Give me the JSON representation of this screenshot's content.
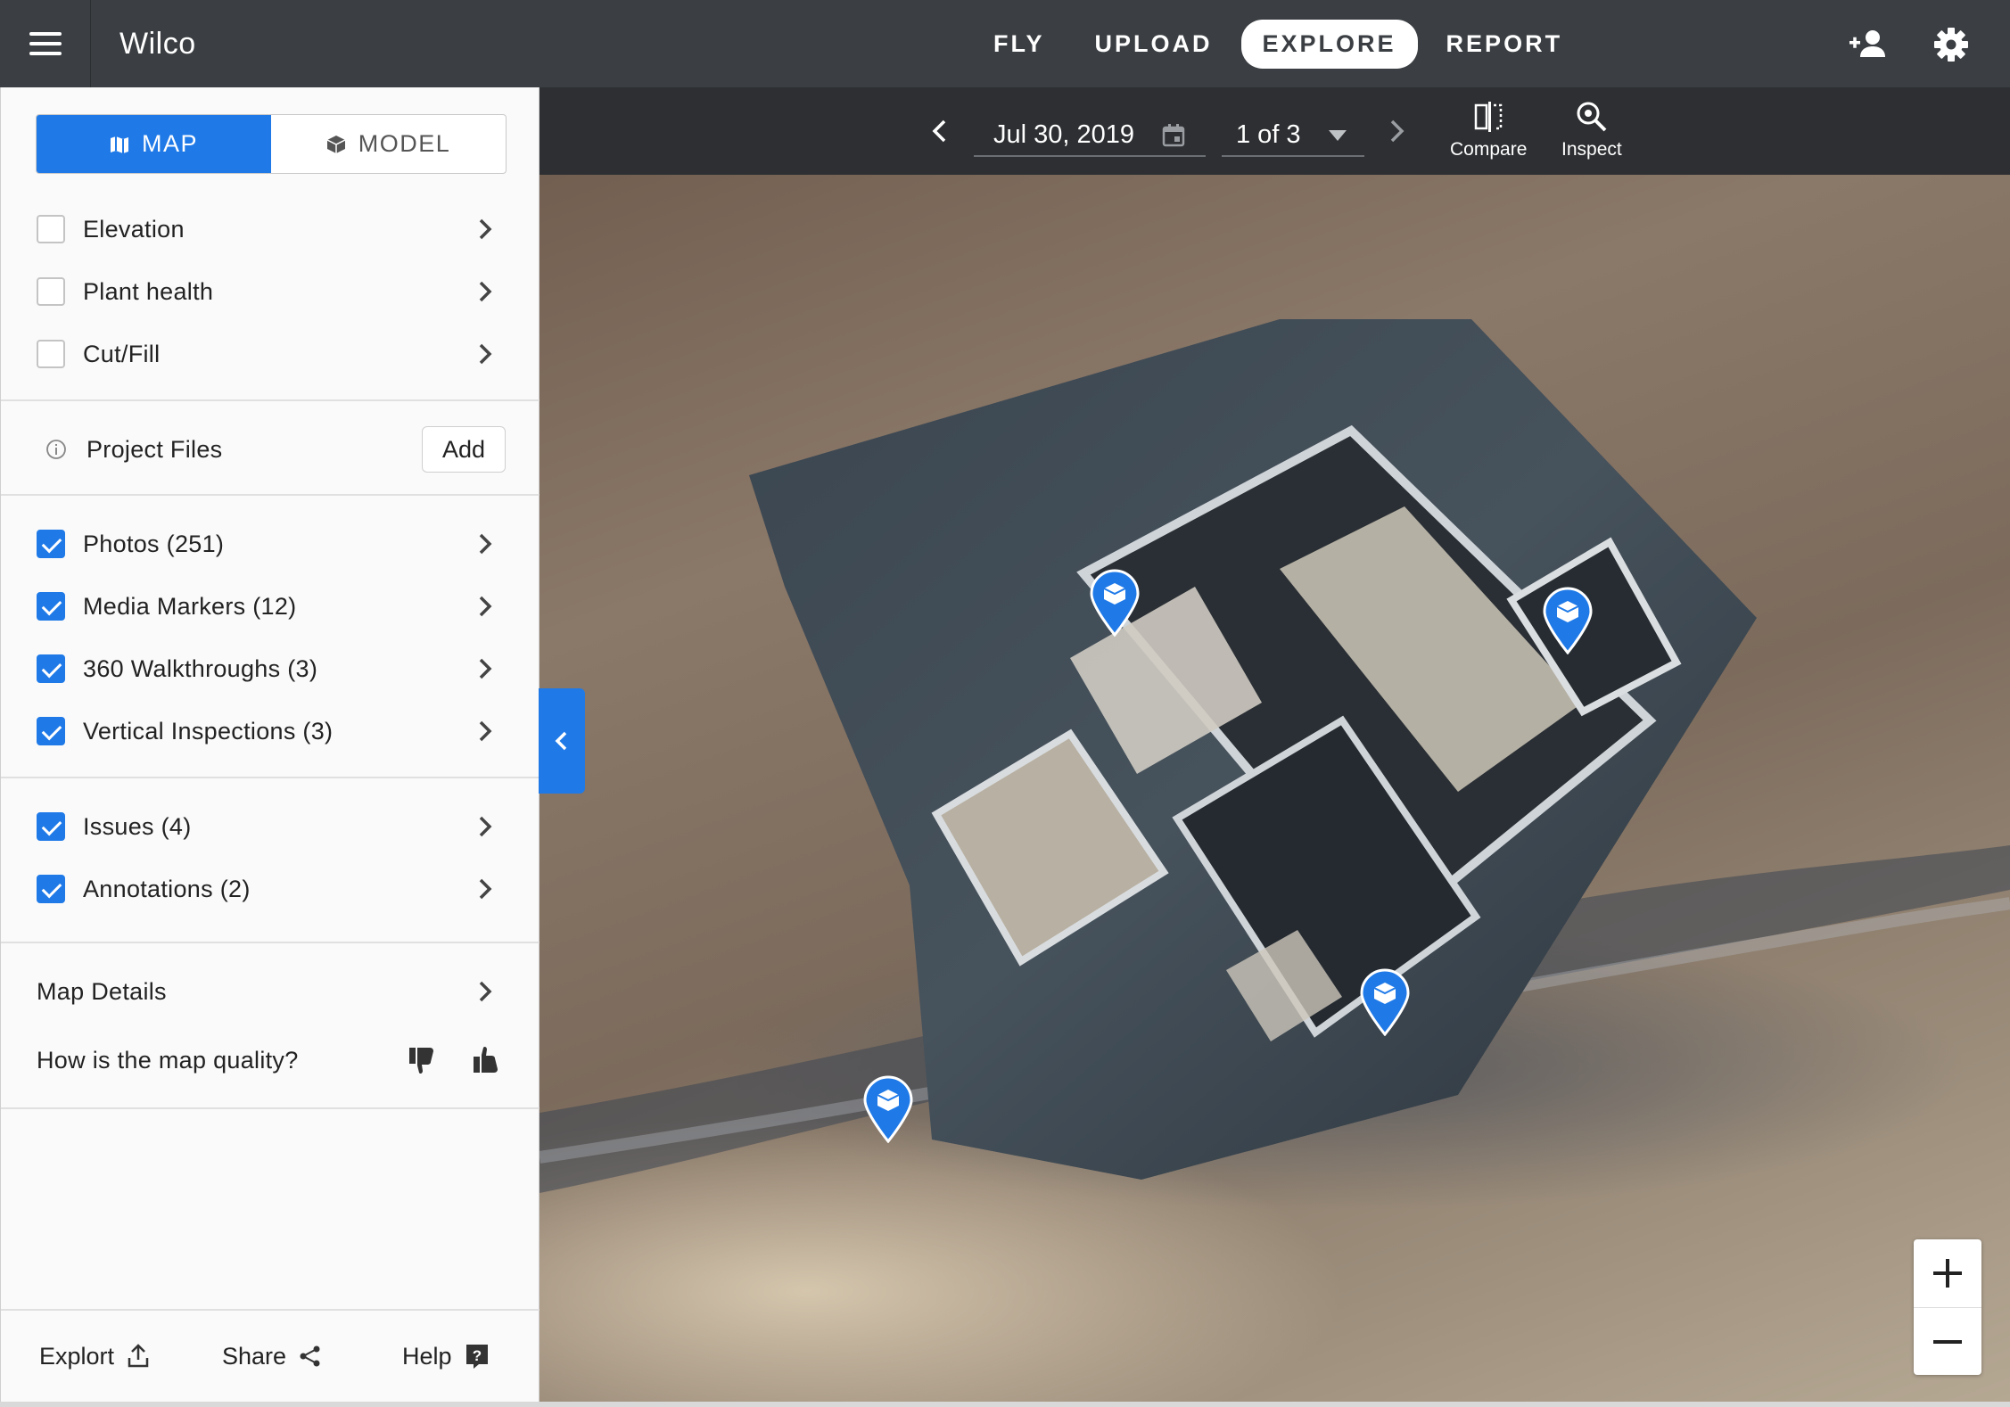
{
  "app": {
    "title": "Wilco"
  },
  "nav": {
    "items": [
      {
        "label": "FLY",
        "active": false
      },
      {
        "label": "UPLOAD",
        "active": false
      },
      {
        "label": "EXPLORE",
        "active": true
      },
      {
        "label": "REPORT",
        "active": false
      }
    ]
  },
  "sidebar": {
    "view_toggle": {
      "map_label": "MAP",
      "model_label": "MODEL",
      "selected": "MAP"
    },
    "layers": [
      {
        "label": "Elevation",
        "checked": false
      },
      {
        "label": "Plant health",
        "checked": false
      },
      {
        "label": "Cut/Fill",
        "checked": false
      }
    ],
    "project_files": {
      "label": "Project Files",
      "add_label": "Add"
    },
    "content": [
      {
        "label": "Photos (251)",
        "checked": true
      },
      {
        "label": "Media Markers (12)",
        "checked": true
      },
      {
        "label": "360 Walkthroughs (3)",
        "checked": true
      },
      {
        "label": "Vertical Inspections (3)",
        "checked": true
      }
    ],
    "issues": [
      {
        "label": "Issues (4)",
        "checked": true
      },
      {
        "label": "Annotations (2)",
        "checked": true
      }
    ],
    "map_details": {
      "label": "Map Details"
    },
    "quality": {
      "label": "How is the map quality?"
    },
    "footer": {
      "export_label": "Explort",
      "share_label": "Share",
      "help_label": "Help"
    }
  },
  "toolbar": {
    "date": "Jul 30, 2019",
    "page": "1 of 3",
    "compare_label": "Compare",
    "inspect_label": "Inspect"
  },
  "colors": {
    "accent": "#1f7ae8",
    "topbar": "#3b3f43",
    "toolbar": "#2d2f32"
  }
}
